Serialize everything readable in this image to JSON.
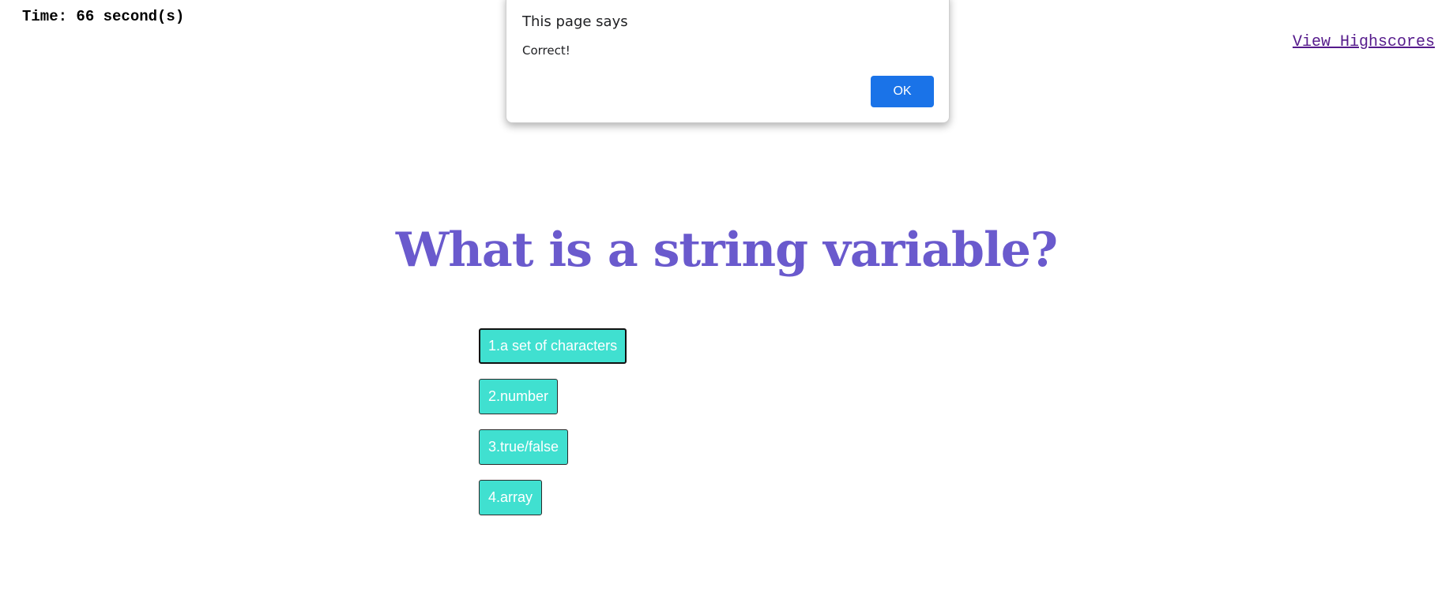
{
  "header": {
    "timer_text": "Time: 66 second(s)",
    "highscores_link": "View Highscores"
  },
  "quiz": {
    "question": "What is a string variable?",
    "answers": [
      "1.a set of characters",
      "2.number",
      "3.true/false",
      "4.array"
    ]
  },
  "dialog": {
    "title": "This page says",
    "message": "Correct!",
    "ok_label": "OK"
  },
  "colors": {
    "question": "#6a5acd",
    "answer_bg": "#40e0d0",
    "ok_button": "#1a73e8",
    "link": "#551a8b"
  }
}
